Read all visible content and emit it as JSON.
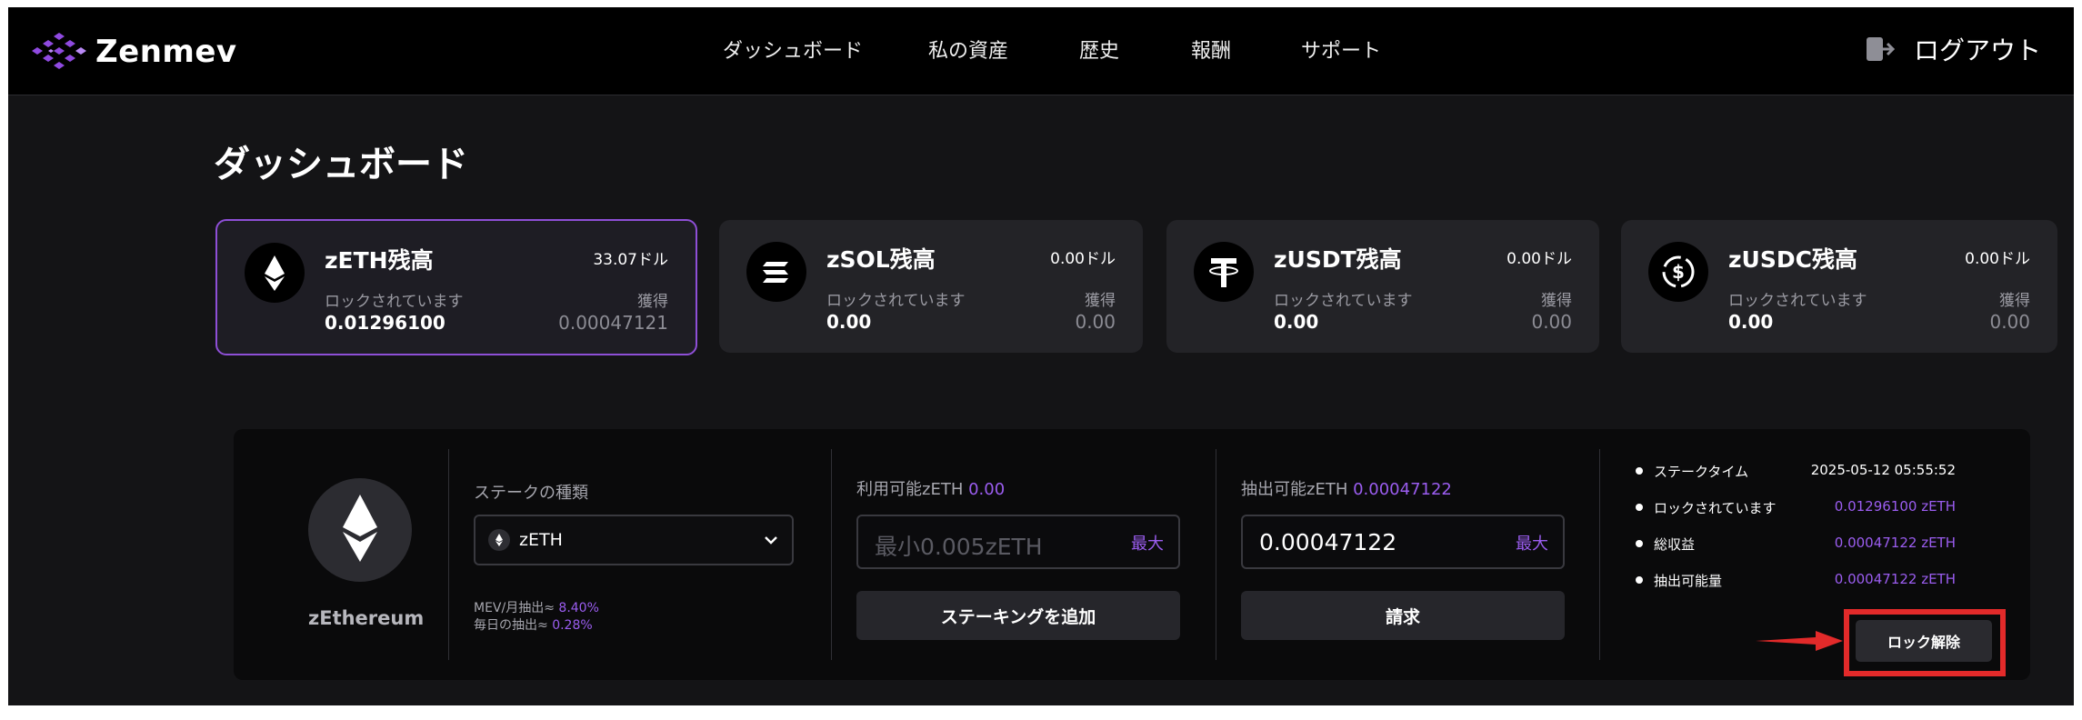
{
  "brand": {
    "name": "Zenmev"
  },
  "nav": [
    "ダッシュボード",
    "私の資産",
    "歴史",
    "報酬",
    "サポート"
  ],
  "logout_label": "ログアウト",
  "page_title": "ダッシュボード",
  "cards": [
    {
      "title": "zETH残高",
      "total": "33.07ドル",
      "lock_label": "ロックされています",
      "lock_value": "0.01296100",
      "earn_label": "獲得",
      "earn_value": "0.00047121",
      "icon": "eth-icon"
    },
    {
      "title": "zSOL残高",
      "total": "0.00ドル",
      "lock_label": "ロックされています",
      "lock_value": "0.00",
      "earn_label": "獲得",
      "earn_value": "0.00",
      "icon": "sol-icon"
    },
    {
      "title": "zUSDT残高",
      "total": "0.00ドル",
      "lock_label": "ロックされています",
      "lock_value": "0.00",
      "earn_label": "獲得",
      "earn_value": "0.00",
      "icon": "usdt-icon"
    },
    {
      "title": "zUSDC残高",
      "total": "0.00ドル",
      "lock_label": "ロックされています",
      "lock_value": "0.00",
      "earn_label": "獲得",
      "earn_value": "0.00",
      "icon": "usdc-icon"
    }
  ],
  "stake": {
    "coin_name": "zEthereum",
    "type_label": "ステークの種類",
    "selected_token": "zETH",
    "mev_label": "MEV/月抽出≈",
    "mev_value": "8.40%",
    "daily_label": "毎日の抽出≈",
    "daily_value": "0.28%",
    "available_label": "利用可能zETH",
    "available_value": "0.00",
    "stake_placeholder": "最小0.005zETH",
    "max_label": "最大",
    "add_stake_button": "ステーキングを追加",
    "withdrawable_label": "抽出可能zETH",
    "withdrawable_value": "0.00047122",
    "claim_input_value": "0.00047122",
    "claim_button": "請求",
    "info": [
      {
        "label": "ステークタイム",
        "value": "2025-05-12 05:55:52"
      },
      {
        "label": "ロックされています",
        "value": "0.01296100 zETH"
      },
      {
        "label": "総収益",
        "value": "0.00047122 zETH"
      },
      {
        "label": "抽出可能量",
        "value": "0.00047122 zETH"
      }
    ],
    "unlock_button": "ロック解除"
  },
  "colors": {
    "accent": "#9b5df0",
    "highlight": "#e22a2a",
    "background": "#141416"
  }
}
